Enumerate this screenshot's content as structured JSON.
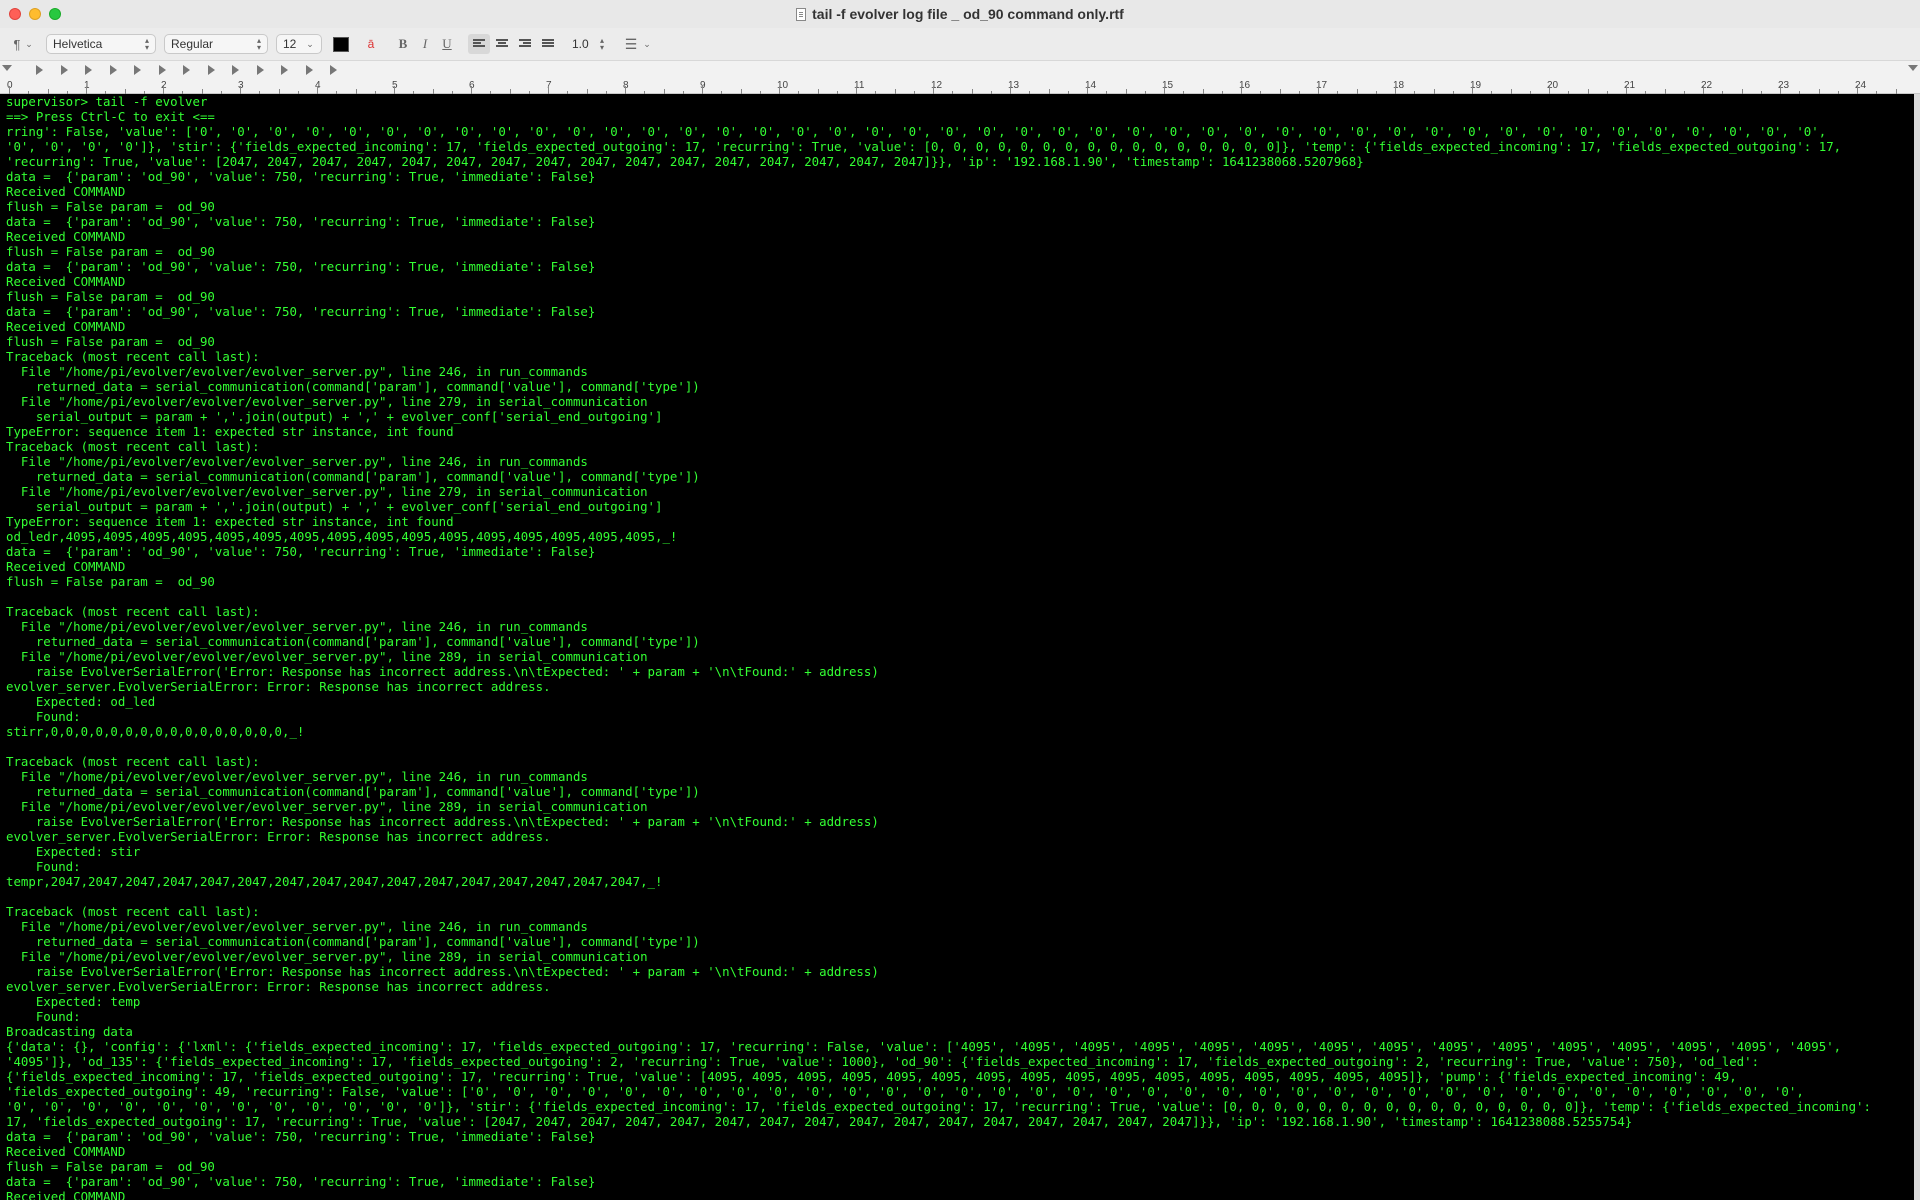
{
  "window": {
    "title": "tail -f evolver log file _ od_90 command only.rtf"
  },
  "toolbar": {
    "paragraph_style": "¶",
    "font_family": "Helvetica",
    "font_style": "Regular",
    "font_size": "12",
    "line_spacing": "1.0",
    "bold_label": "B",
    "italic_label": "I",
    "underline_label": "U",
    "text_color": "#000000"
  },
  "ruler": {
    "numbers": [
      "0",
      "1",
      "2",
      "3",
      "4",
      "5",
      "6",
      "7",
      "8",
      "9",
      "10",
      "11",
      "12",
      "13",
      "14",
      "15",
      "16",
      "17",
      "18",
      "19",
      "20",
      "21",
      "22",
      "23",
      "24"
    ]
  },
  "document": {
    "text_color": "#33ff33",
    "background": "#000000",
    "lines": [
      "supervisor> tail -f evolver",
      "==> Press Ctrl-C to exit <==",
      "rring': False, 'value': ['0', '0', '0', '0', '0', '0', '0', '0', '0', '0', '0', '0', '0', '0', '0', '0', '0', '0', '0', '0', '0', '0', '0', '0', '0', '0', '0', '0', '0', '0', '0', '0', '0', '0', '0', '0', '0', '0', '0', '0', '0', '0', '0', '0',",
      "'0', '0', '0', '0']}, 'stir': {'fields_expected_incoming': 17, 'fields_expected_outgoing': 17, 'recurring': True, 'value': [0, 0, 0, 0, 0, 0, 0, 0, 0, 0, 0, 0, 0, 0, 0, 0]}, 'temp': {'fields_expected_incoming': 17, 'fields_expected_outgoing': 17,",
      "'recurring': True, 'value': [2047, 2047, 2047, 2047, 2047, 2047, 2047, 2047, 2047, 2047, 2047, 2047, 2047, 2047, 2047, 2047]}}, 'ip': '192.168.1.90', 'timestamp': 1641238068.5207968}",
      "data =  {'param': 'od_90', 'value': 750, 'recurring': True, 'immediate': False}",
      "Received COMMAND",
      "flush = False param =  od_90",
      "data =  {'param': 'od_90', 'value': 750, 'recurring': True, 'immediate': False}",
      "Received COMMAND",
      "flush = False param =  od_90",
      "data =  {'param': 'od_90', 'value': 750, 'recurring': True, 'immediate': False}",
      "Received COMMAND",
      "flush = False param =  od_90",
      "data =  {'param': 'od_90', 'value': 750, 'recurring': True, 'immediate': False}",
      "Received COMMAND",
      "flush = False param =  od_90",
      "Traceback (most recent call last):",
      "  File \"/home/pi/evolver/evolver/evolver_server.py\", line 246, in run_commands",
      "    returned_data = serial_communication(command['param'], command['value'], command['type'])",
      "  File \"/home/pi/evolver/evolver/evolver_server.py\", line 279, in serial_communication",
      "    serial_output = param + ','.join(output) + ',' + evolver_conf['serial_end_outgoing']",
      "TypeError: sequence item 1: expected str instance, int found",
      "Traceback (most recent call last):",
      "  File \"/home/pi/evolver/evolver/evolver_server.py\", line 246, in run_commands",
      "    returned_data = serial_communication(command['param'], command['value'], command['type'])",
      "  File \"/home/pi/evolver/evolver/evolver_server.py\", line 279, in serial_communication",
      "    serial_output = param + ','.join(output) + ',' + evolver_conf['serial_end_outgoing']",
      "TypeError: sequence item 1: expected str instance, int found",
      "od_ledr,4095,4095,4095,4095,4095,4095,4095,4095,4095,4095,4095,4095,4095,4095,4095,4095,_!",
      "data =  {'param': 'od_90', 'value': 750, 'recurring': True, 'immediate': False}",
      "Received COMMAND",
      "flush = False param =  od_90",
      "",
      "Traceback (most recent call last):",
      "  File \"/home/pi/evolver/evolver/evolver_server.py\", line 246, in run_commands",
      "    returned_data = serial_communication(command['param'], command['value'], command['type'])",
      "  File \"/home/pi/evolver/evolver/evolver_server.py\", line 289, in serial_communication",
      "    raise EvolverSerialError('Error: Response has incorrect address.\\n\\tExpected: ' + param + '\\n\\tFound:' + address)",
      "evolver_server.EvolverSerialError: Error: Response has incorrect address.",
      "    Expected: od_led",
      "    Found:",
      "stirr,0,0,0,0,0,0,0,0,0,0,0,0,0,0,0,0,_!",
      "",
      "Traceback (most recent call last):",
      "  File \"/home/pi/evolver/evolver/evolver_server.py\", line 246, in run_commands",
      "    returned_data = serial_communication(command['param'], command['value'], command['type'])",
      "  File \"/home/pi/evolver/evolver/evolver_server.py\", line 289, in serial_communication",
      "    raise EvolverSerialError('Error: Response has incorrect address.\\n\\tExpected: ' + param + '\\n\\tFound:' + address)",
      "evolver_server.EvolverSerialError: Error: Response has incorrect address.",
      "    Expected: stir",
      "    Found:",
      "tempr,2047,2047,2047,2047,2047,2047,2047,2047,2047,2047,2047,2047,2047,2047,2047,2047,_!",
      "",
      "Traceback (most recent call last):",
      "  File \"/home/pi/evolver/evolver/evolver_server.py\", line 246, in run_commands",
      "    returned_data = serial_communication(command['param'], command['value'], command['type'])",
      "  File \"/home/pi/evolver/evolver/evolver_server.py\", line 289, in serial_communication",
      "    raise EvolverSerialError('Error: Response has incorrect address.\\n\\tExpected: ' + param + '\\n\\tFound:' + address)",
      "evolver_server.EvolverSerialError: Error: Response has incorrect address.",
      "    Expected: temp",
      "    Found:",
      "Broadcasting data",
      "{'data': {}, 'config': {'lxml': {'fields_expected_incoming': 17, 'fields_expected_outgoing': 17, 'recurring': False, 'value': ['4095', '4095', '4095', '4095', '4095', '4095', '4095', '4095', '4095', '4095', '4095', '4095', '4095', '4095', '4095',",
      "'4095']}, 'od_135': {'fields_expected_incoming': 17, 'fields_expected_outgoing': 2, 'recurring': True, 'value': 1000}, 'od_90': {'fields_expected_incoming': 17, 'fields_expected_outgoing': 2, 'recurring': True, 'value': 750}, 'od_led':",
      "{'fields_expected_incoming': 17, 'fields_expected_outgoing': 17, 'recurring': True, 'value': [4095, 4095, 4095, 4095, 4095, 4095, 4095, 4095, 4095, 4095, 4095, 4095, 4095, 4095, 4095, 4095]}, 'pump': {'fields_expected_incoming': 49,",
      "'fields_expected_outgoing': 49, 'recurring': False, 'value': ['0', '0', '0', '0', '0', '0', '0', '0', '0', '0', '0', '0', '0', '0', '0', '0', '0', '0', '0', '0', '0', '0', '0', '0', '0', '0', '0', '0', '0', '0', '0', '0', '0', '0', '0', '0',",
      "'0', '0', '0', '0', '0', '0', '0', '0', '0', '0', '0', '0']}, 'stir': {'fields_expected_incoming': 17, 'fields_expected_outgoing': 17, 'recurring': True, 'value': [0, 0, 0, 0, 0, 0, 0, 0, 0, 0, 0, 0, 0, 0, 0, 0]}, 'temp': {'fields_expected_incoming':",
      "17, 'fields_expected_outgoing': 17, 'recurring': True, 'value': [2047, 2047, 2047, 2047, 2047, 2047, 2047, 2047, 2047, 2047, 2047, 2047, 2047, 2047, 2047, 2047]}}, 'ip': '192.168.1.90', 'timestamp': 1641238088.5255754}",
      "data =  {'param': 'od_90', 'value': 750, 'recurring': True, 'immediate': False}",
      "Received COMMAND",
      "flush = False param =  od_90",
      "data =  {'param': 'od_90', 'value': 750, 'recurring': True, 'immediate': False}",
      "Received COMMAND"
    ]
  }
}
